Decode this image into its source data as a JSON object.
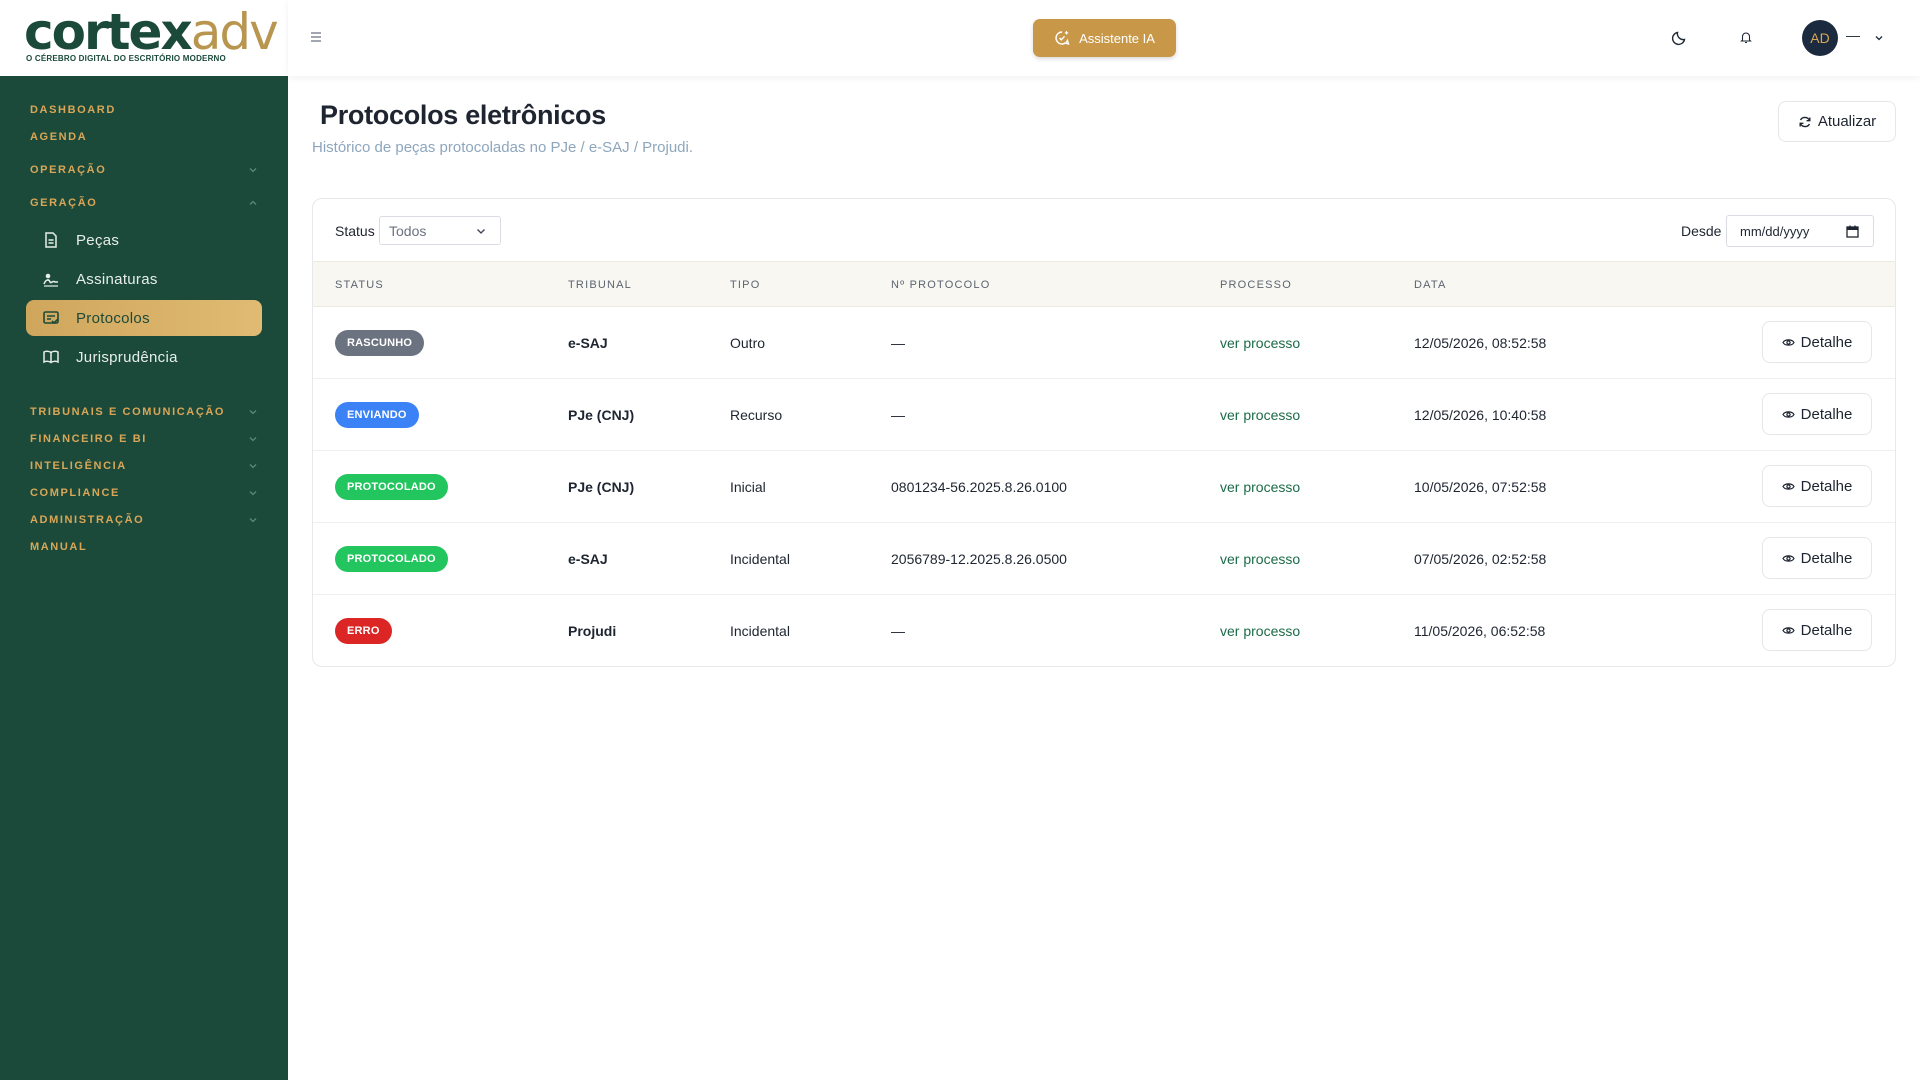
{
  "brand": {
    "logo_main": "cortex",
    "logo_accent": "adv",
    "tagline": "O CÉREBRO DIGITAL DO ESCRITÓRIO MODERNO"
  },
  "sidebar": {
    "dashboard": "DASHBOARD",
    "agenda": "AGENDA",
    "operacao": "OPERAÇÃO",
    "geracao": "GERAÇÃO",
    "sub_items": [
      {
        "label": "Peças",
        "icon": "document-icon"
      },
      {
        "label": "Assinaturas",
        "icon": "signature-icon"
      },
      {
        "label": "Protocolos",
        "icon": "protocol-icon",
        "active": true
      },
      {
        "label": "Jurisprudência",
        "icon": "book-icon"
      }
    ],
    "tribunais": "TRIBUNAIS E COMUNICAÇÃO",
    "financeiro": "FINANCEIRO E BI",
    "inteligencia": "INTELIGÊNCIA",
    "compliance": "COMPLIANCE",
    "administracao": "ADMINISTRAÇÃO",
    "manual": "MANUAL"
  },
  "topbar": {
    "ai_button": "Assistente IA",
    "avatar_initials": "AD",
    "user_name": "—"
  },
  "page": {
    "title": "Protocolos eletrônicos",
    "subtitle": "Histórico de peças protocoladas no PJe / e-SAJ / Projudi.",
    "refresh_label": "Atualizar"
  },
  "filters": {
    "status_label": "Status",
    "status_value": "Todos",
    "desde_label": "Desde",
    "date_placeholder": "mm/dd/yyyy"
  },
  "table": {
    "headers": [
      "STATUS",
      "TRIBUNAL",
      "TIPO",
      "Nº PROTOCOLO",
      "PROCESSO",
      "DATA"
    ],
    "detail_label": "Detalhe",
    "rows": [
      {
        "status": "RASCUNHO",
        "status_color": "#6b7280",
        "tribunal": "e-SAJ",
        "tipo": "Outro",
        "protocolo": "—",
        "processo": "ver processo",
        "data": "12/05/2026, 08:52:58"
      },
      {
        "status": "ENVIANDO",
        "status_color": "#3b82f6",
        "tribunal": "PJe (CNJ)",
        "tipo": "Recurso",
        "protocolo": "—",
        "processo": "ver processo",
        "data": "12/05/2026, 10:40:58"
      },
      {
        "status": "PROTOCOLADO",
        "status_color": "#22c55e",
        "tribunal": "PJe (CNJ)",
        "tipo": "Inicial",
        "protocolo": "0801234-56.2025.8.26.0100",
        "processo": "ver processo",
        "data": "10/05/2026, 07:52:58"
      },
      {
        "status": "PROTOCOLADO",
        "status_color": "#22c55e",
        "tribunal": "e-SAJ",
        "tipo": "Incidental",
        "protocolo": "2056789-12.2025.8.26.0500",
        "processo": "ver processo",
        "data": "07/05/2026, 02:52:58"
      },
      {
        "status": "ERRO",
        "status_color": "#dc2626",
        "tribunal": "Projudi",
        "tipo": "Incidental",
        "protocolo": "—",
        "processo": "ver processo",
        "data": "11/05/2026, 06:52:58"
      }
    ]
  },
  "colors": {
    "sidebar_bg": "#1b4a3a",
    "accent_gold": "#c89848",
    "link_green": "#1b6b4a"
  }
}
